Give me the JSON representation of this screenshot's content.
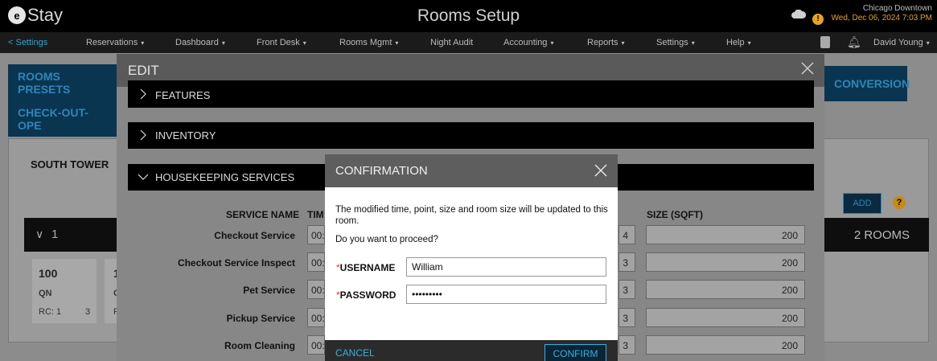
{
  "header": {
    "logo_letter": "e",
    "logo_text": "Stay",
    "title": "Rooms Setup",
    "location": "Chicago Downtown",
    "datetime": "Wed, Dec 06, 2024 7:03 PM",
    "icons": [
      "cloud-icon",
      "warning-icon"
    ]
  },
  "nav": {
    "back": "< Settings",
    "items": [
      {
        "label": "Reservations",
        "caret": true
      },
      {
        "label": "Dashboard",
        "caret": true
      },
      {
        "label": "Front Desk",
        "caret": true
      },
      {
        "label": "Rooms Mgmt",
        "caret": true
      },
      {
        "label": "Night Audit",
        "caret": false
      },
      {
        "label": "Accounting",
        "caret": true
      },
      {
        "label": "Reports",
        "caret": true
      },
      {
        "label": "Settings",
        "caret": true
      },
      {
        "label": "Help",
        "caret": true
      }
    ],
    "user": "David Young",
    "user_caret": "▾",
    "caret_symbol": "▾"
  },
  "background": {
    "tiles": [
      "ROOMS PRESETS",
      "CHECK-OUT-OPE",
      "CONVERSION"
    ],
    "tower": "SOUTH TOWER",
    "group_chevron": "∨",
    "group_label": "1",
    "room_count": "2 ROOMS",
    "add_label": "ADD",
    "help_glyph": "?",
    "card": {
      "number": "100",
      "type": "QN",
      "rc": "RC: 1",
      "extra": "3",
      "number2": "1",
      "type2": "C",
      "extra2": "F"
    }
  },
  "edit": {
    "title": "EDIT",
    "sections": [
      "FEATURES",
      "INVENTORY",
      "HOUSEKEEPING SERVICES"
    ],
    "columns": {
      "service": "SERVICE NAME",
      "time": "TIM",
      "size": "SIZE (SQFT)"
    },
    "services": [
      {
        "name": "Checkout Service",
        "time": "00:",
        "points": "4",
        "size": "200"
      },
      {
        "name": "Checkout Service Inspect",
        "time": "00:",
        "points": "3",
        "size": "200"
      },
      {
        "name": "Pet Service",
        "time": "00:",
        "points": "3",
        "size": "200"
      },
      {
        "name": "Pickup Service",
        "time": "00:",
        "points": "3",
        "size": "200"
      },
      {
        "name": "Room Cleaning",
        "time": "00:",
        "points": "3",
        "size": "200"
      }
    ]
  },
  "confirm": {
    "title": "CONFIRMATION",
    "message": "The modified time, point, size and room size will be updated to this room.",
    "question": "Do you want to proceed?",
    "required_mark": "*",
    "username_label": "USERNAME",
    "username_value": "William",
    "password_label": "PASSWORD",
    "password_value": "•••••••••",
    "cancel": "CANCEL",
    "confirm": "CONFIRM"
  },
  "colors": {
    "accent": "#2fb3e6",
    "warning": "#e8a317",
    "required": "#d23b2a"
  }
}
